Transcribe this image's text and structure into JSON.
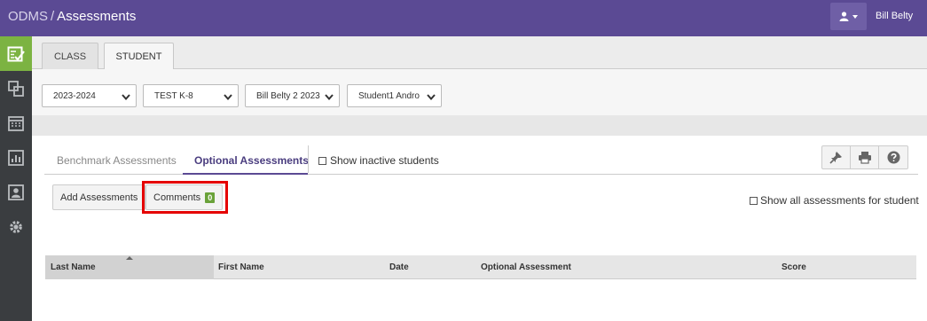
{
  "header": {
    "app_name": "ODMS",
    "separator": "/",
    "page_title": "Assessments",
    "user_name": "Bill Belty",
    "user_icon": "user-icon",
    "caret_icon": "caret-down-icon"
  },
  "sidenav": {
    "items": [
      {
        "icon": "assessment-check-icon",
        "active": true
      },
      {
        "icon": "copy-icon",
        "active": false
      },
      {
        "icon": "calendar-icon",
        "active": false
      },
      {
        "icon": "bar-chart-icon",
        "active": false
      },
      {
        "icon": "person-card-icon",
        "active": false
      },
      {
        "icon": "gear-icon",
        "active": false
      }
    ],
    "active_color": "#7cb342"
  },
  "top_tabs": [
    {
      "label": "CLASS",
      "active": false
    },
    {
      "label": "STUDENT",
      "active": true
    }
  ],
  "filters": [
    {
      "value": "2023-2024"
    },
    {
      "value": "TEST K-8"
    },
    {
      "value": "Bill Belty 2 2023"
    },
    {
      "value": "Student1 Andro"
    }
  ],
  "sub_tabs": [
    {
      "label": "Benchmark Assessments",
      "active": false
    },
    {
      "label": "Optional Assessments",
      "active": true
    }
  ],
  "show_inactive_label": "Show inactive students",
  "toolbar": {
    "icons": [
      "pin-icon",
      "print-icon",
      "help-icon"
    ]
  },
  "actions": {
    "add_label": "Add Assessments",
    "comments_label": "Comments",
    "comments_count": "0"
  },
  "show_all_label": "Show all assessments for student",
  "table": {
    "columns": [
      "Last Name",
      "First Name",
      "Date",
      "Optional Assessment",
      "Score"
    ],
    "sorted_column": "Last Name",
    "rows": []
  },
  "colors": {
    "header_bg": "#5b4a94",
    "sidebar_bg": "#3a3d40",
    "badge_green": "#6aa23a",
    "highlight_red": "#e50000"
  }
}
